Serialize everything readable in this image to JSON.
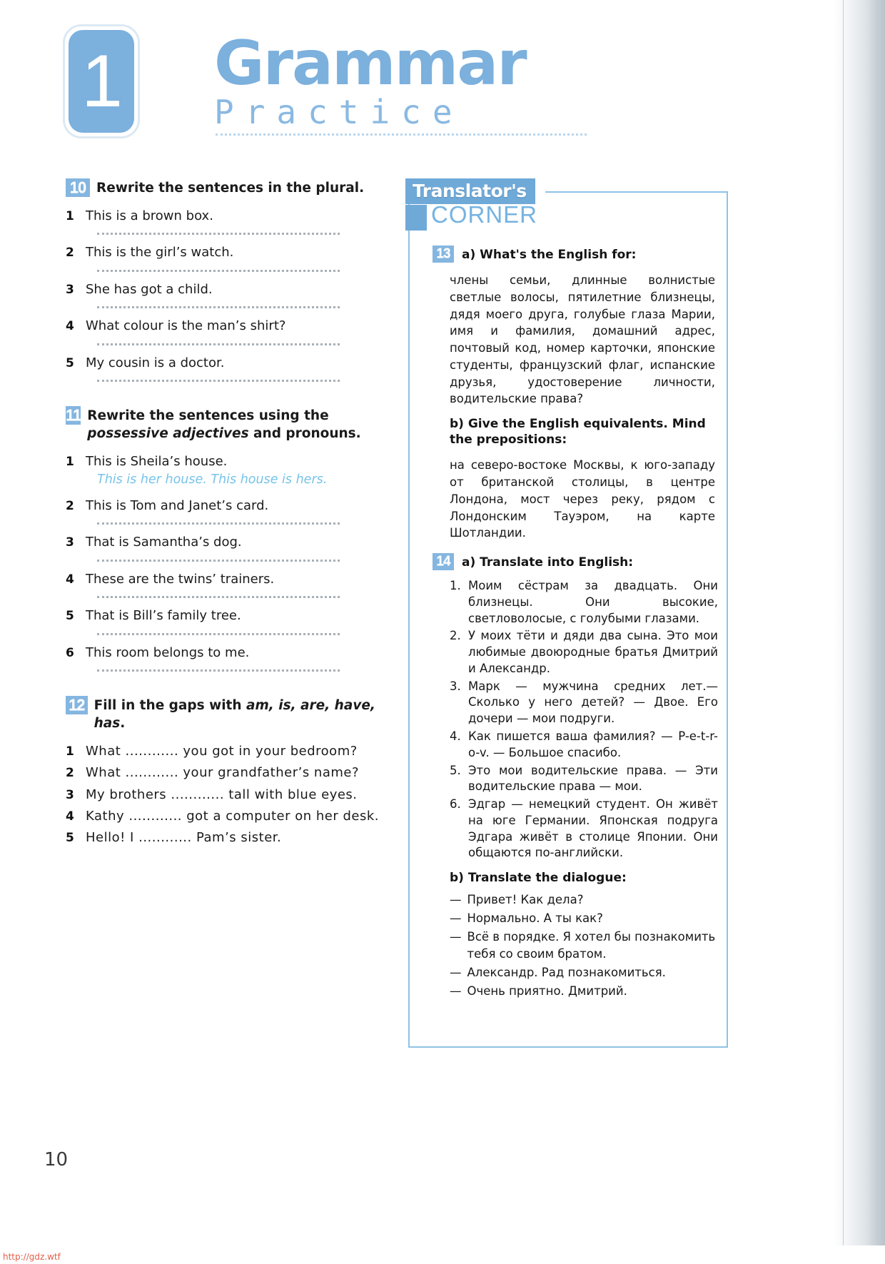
{
  "header": {
    "unit_number": "1",
    "title_main": "Grammar",
    "title_sub": "Practice"
  },
  "footer": {
    "page_number": "10",
    "watermark_url": "http://gdz.wtf"
  },
  "left_column": {
    "exercise_10": {
      "number": "10",
      "instruction": "Rewrite the sentences in the plural.",
      "items": [
        {
          "num": "1",
          "text": "This is a brown box."
        },
        {
          "num": "2",
          "text": "This is the girl’s watch."
        },
        {
          "num": "3",
          "text": "She has got a child."
        },
        {
          "num": "4",
          "text": "What colour is the man’s shirt?"
        },
        {
          "num": "5",
          "text": "My cousin is a doctor."
        }
      ]
    },
    "exercise_11": {
      "number": "11",
      "instruction_part1": "Rewrite the sentences using the ",
      "instruction_italic": "possessive adjectives",
      "instruction_part2": " and pronouns.",
      "items": [
        {
          "num": "1",
          "text": "This is Sheila’s house.",
          "sample": "This is her house. This house is hers."
        },
        {
          "num": "2",
          "text": "This is Tom and Janet’s card."
        },
        {
          "num": "3",
          "text": "That is Samantha’s dog."
        },
        {
          "num": "4",
          "text": "These are the twins’ trainers."
        },
        {
          "num": "5",
          "text": "That is Bill’s family tree."
        },
        {
          "num": "6",
          "text": "This room belongs to me."
        }
      ]
    },
    "exercise_12": {
      "number": "12",
      "instruction_prefix": "Fill in the gaps with ",
      "instruction_words": "am, is, are, have, has",
      "instruction_suffix": ".",
      "items": [
        {
          "num": "1",
          "text": "What ............ you got in your bedroom?"
        },
        {
          "num": "2",
          "text": "What ............ your grandfather’s name?"
        },
        {
          "num": "3",
          "text": "My brothers ............ tall with blue eyes."
        },
        {
          "num": "4",
          "text": "Kathy ............ got a computer on her desk."
        },
        {
          "num": "5",
          "text": "Hello! I ............ Pam’s sister."
        }
      ]
    }
  },
  "right_column": {
    "corner_title_tag": "Translator's",
    "corner_title_word": "CORNER",
    "exercise_13": {
      "number": "13",
      "heading_a": "a) What's the English for:",
      "text_a": "члены семьи, длинные волнистые светлые волосы, пятилетние близнецы, дядя моего друга, голубые глаза Марии, имя и фамилия, домашний адрес, почтовый код, номер карточки, японские студенты, французский флаг, испанские друзья, удостоверение личности, водительские права?",
      "heading_b": "b) Give the English equivalents. Mind the prepositions:",
      "text_b": "на северо-востоке Москвы, к юго-западу от британской столицы, в центре Лондона, мост через реку, рядом с Лондонским Тауэром, на карте Шотландии."
    },
    "exercise_14": {
      "number": "14",
      "heading_a": "a) Translate into English:",
      "items": [
        {
          "num": "1.",
          "text": "Моим сёстрам за двадцать. Они близнецы. Они высокие, светловолосые, с голубыми глазами."
        },
        {
          "num": "2.",
          "text": "У моих тёти и дяди два сына. Это мои любимые двоюродные братья Дмитрий и Александр."
        },
        {
          "num": "3.",
          "text": "Марк — мужчина средних лет.— Сколько у него детей? — Двое. Его дочери — мои подруги."
        },
        {
          "num": "4.",
          "text": "Как пишется ваша фамилия? — P-e-t-r-o-v. — Большое спасибо."
        },
        {
          "num": "5.",
          "text": "Это мои водительские права. — Эти водительские права — мои."
        },
        {
          "num": "6.",
          "text": "Эдгар — немецкий студент. Он живёт на юге Германии. Японская подруга Эдгара живёт в столице Японии. Они общаются по-английски."
        }
      ],
      "heading_b": "b) Translate the dialogue:",
      "dialogue": [
        {
          "dash": "—",
          "text": "Привет! Как дела?"
        },
        {
          "dash": "—",
          "text": "Нормально. А ты как?"
        },
        {
          "dash": "—",
          "text": "Всё в порядке. Я хотел бы познакомить тебя со своим братом."
        },
        {
          "dash": "—",
          "text": "Александр. Рад познакомиться."
        },
        {
          "dash": "—",
          "text": "Очень приятно. Дмитрий."
        }
      ]
    }
  }
}
